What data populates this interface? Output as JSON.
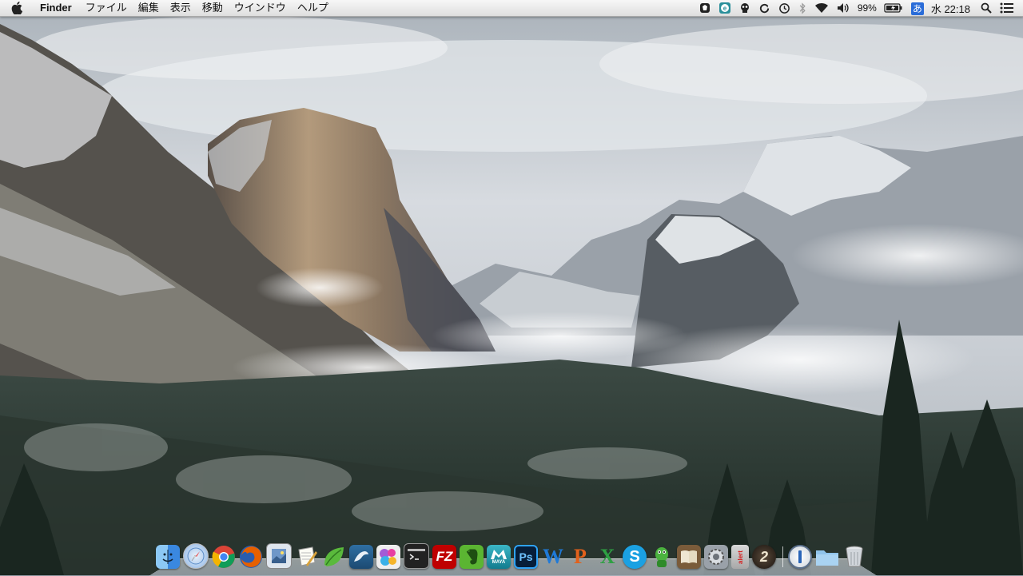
{
  "menubar": {
    "app_name": "Finder",
    "menus": [
      "ファイル",
      "編集",
      "表示",
      "移動",
      "ウインドウ",
      "ヘルプ"
    ],
    "status": {
      "battery_percent": "99%",
      "input_method": "あ",
      "clock": "水 22:18",
      "icons": [
        "evernote-icon",
        "e-app-icon",
        "alien-icon",
        "sync-icon",
        "time-machine-icon",
        "bluetooth-icon",
        "wifi-icon",
        "volume-icon",
        "battery-icon",
        "input-method-icon",
        "spotlight-icon",
        "notification-center-icon"
      ]
    }
  },
  "dock": {
    "apps": [
      {
        "name": "Finder",
        "icon": "finder-icon"
      },
      {
        "name": "Safari",
        "icon": "safari-icon"
      },
      {
        "name": "Google Chrome",
        "icon": "chrome-icon"
      },
      {
        "name": "Firefox",
        "icon": "firefox-icon"
      },
      {
        "name": "Preview",
        "icon": "preview-icon"
      },
      {
        "name": "TextEdit",
        "icon": "textedit-icon"
      },
      {
        "name": "Leaf",
        "icon": "leaf-icon"
      },
      {
        "name": "MySQL Workbench",
        "icon": "mysql-icon"
      },
      {
        "name": "Game Center",
        "icon": "game-center-icon"
      },
      {
        "name": "Terminal",
        "icon": "terminal-icon"
      },
      {
        "name": "FileZilla",
        "icon": "filezilla-icon"
      },
      {
        "name": "Evernote",
        "icon": "evernote-icon"
      },
      {
        "name": "Maya",
        "icon": "maya-icon"
      },
      {
        "name": "Photoshop",
        "icon": "photoshop-icon"
      },
      {
        "name": "Word",
        "icon": "word-icon"
      },
      {
        "name": "PowerPoint",
        "icon": "powerpoint-icon"
      },
      {
        "name": "Excel",
        "icon": "excel-icon"
      },
      {
        "name": "Skype",
        "icon": "skype-icon"
      },
      {
        "name": "Adium",
        "icon": "adium-icon"
      },
      {
        "name": "Dictionary",
        "icon": "dictionary-icon"
      },
      {
        "name": "System Preferences",
        "icon": "system-preferences-icon"
      },
      {
        "name": "Alert",
        "icon": "alert-icon"
      },
      {
        "name": "App 2",
        "icon": "two-icon"
      }
    ],
    "docs": [
      {
        "name": "1Password",
        "icon": "onepassword-icon"
      },
      {
        "name": "Folder",
        "icon": "folder-icon"
      },
      {
        "name": "Trash",
        "icon": "trash-icon"
      }
    ],
    "labels": {
      "filezilla": "FZ",
      "maya": "MAYA",
      "photoshop": "Ps",
      "word": "W",
      "powerpoint": "P",
      "excel": "X",
      "skype": "S",
      "alert": "alert",
      "two": "2"
    }
  }
}
